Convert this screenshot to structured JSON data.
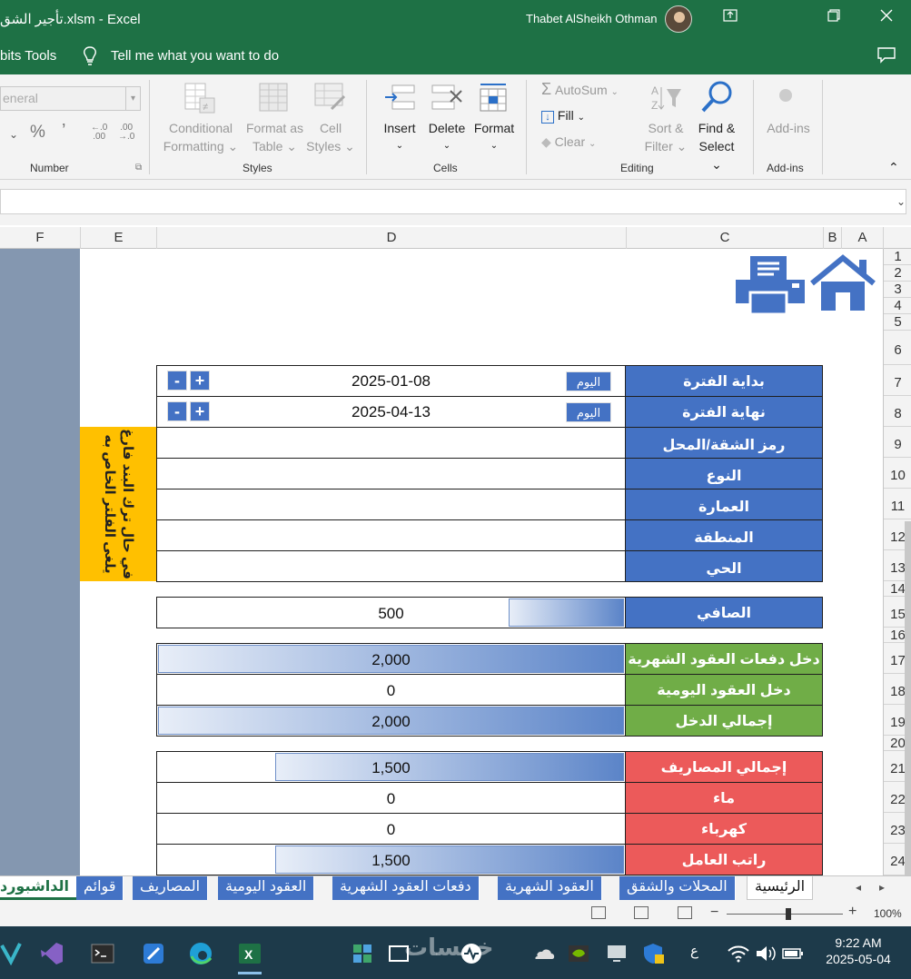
{
  "window": {
    "title": "تأجير الشق.xlsm  -  Excel",
    "user": "Thabet AlSheikh Othman"
  },
  "menu": {
    "tab_partial": "bits Tools",
    "tell_me": "Tell me what you want to do"
  },
  "ribbon": {
    "number_format_value": "eneral",
    "groups": {
      "number": "Number",
      "styles": "Styles",
      "cells": "Cells",
      "editing": "Editing",
      "addins": "Add-ins"
    },
    "styles": {
      "conditional": [
        "Conditional",
        "Formatting"
      ],
      "format_table": [
        "Format as",
        "Table"
      ],
      "cell_styles": [
        "Cell",
        "Styles"
      ]
    },
    "cells": {
      "insert": "Insert",
      "delete": "Delete",
      "format": "Format"
    },
    "editing": {
      "autosum": "AutoSum",
      "fill": "Fill",
      "clear": "Clear",
      "sort": [
        "Sort &",
        "Filter"
      ],
      "find": [
        "Find &",
        "Select"
      ]
    },
    "addins": "Add-ins",
    "percent": "%",
    "comma": "’"
  },
  "columns": [
    "F",
    "E",
    "D",
    "C",
    "B",
    "A"
  ],
  "rows": [
    "1",
    "2",
    "3",
    "4",
    "5",
    "6",
    "7",
    "8",
    "9",
    "10",
    "11",
    "12",
    "13",
    "14",
    "15",
    "16",
    "17",
    "18",
    "19",
    "20",
    "21",
    "22",
    "23",
    "24"
  ],
  "sheet": {
    "note": "في حال ترك البند فارغ يلغى الفلتر الخاص به",
    "today_label": "اليوم",
    "plus": "+",
    "minus": "-",
    "period_start_label": "بداية الفترة",
    "period_start": "2025-01-08",
    "period_end_label": "نهاية الفترة",
    "period_end": "2025-04-13",
    "filters": [
      "رمز الشقة/المحل",
      "النوع",
      "العمارة",
      "المنطقة",
      "الحي"
    ],
    "net_label": "الصافي",
    "net": "500",
    "net_fraction": 0.25,
    "income": [
      {
        "label": "دخل دفعات العقود الشهرية",
        "value": "2,000",
        "fraction": 1.0
      },
      {
        "label": "دخل العقود اليومية",
        "value": "0",
        "fraction": 0
      },
      {
        "label": "إجمالي الدخل",
        "value": "2,000",
        "fraction": 1.0
      }
    ],
    "expenses": [
      {
        "label": "إجمالي المصاريف",
        "value": "1,500",
        "fraction": 0.75
      },
      {
        "label": "ماء",
        "value": "0",
        "fraction": 0
      },
      {
        "label": "كهرباء",
        "value": "0",
        "fraction": 0
      },
      {
        "label": "راتب العامل",
        "value": "1,500",
        "fraction": 0.75
      }
    ]
  },
  "sheet_tabs": [
    "الداشبورد",
    "قوائم",
    "المصاريف",
    "العقود اليومية",
    "دفعات العقود الشهرية",
    "العقود الشهرية",
    "المحلات والشقق",
    "الرئيسية"
  ],
  "status": {
    "zoom": "100%"
  },
  "taskbar": {
    "time": "9:22 AM",
    "date": "2025-05-04",
    "lang": "ع",
    "watermark": "خمسات"
  },
  "colors": {
    "excel_green": "#1e7145",
    "blue": "#4472c4",
    "green": "#70ad47",
    "red": "#ec5a5a",
    "note_yellow": "#ffc000",
    "col_f": "#8497b0"
  }
}
